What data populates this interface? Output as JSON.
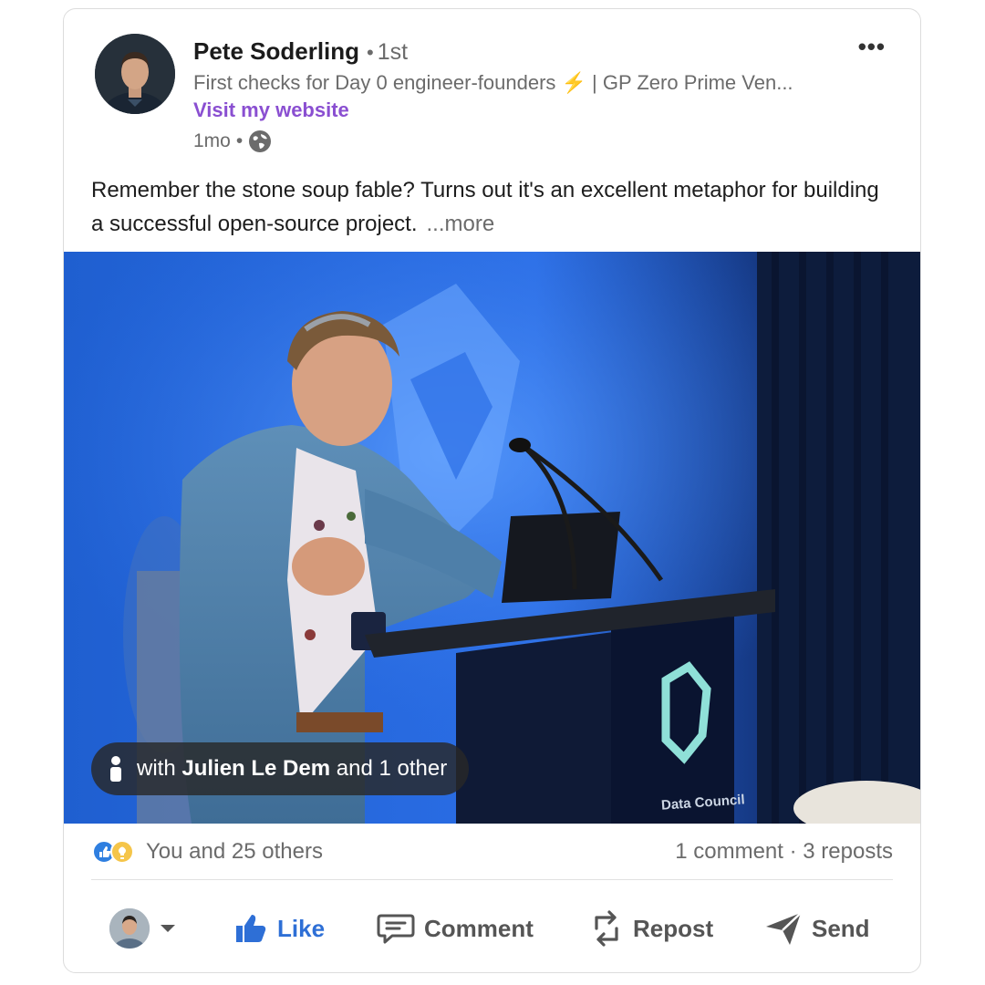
{
  "post": {
    "author": {
      "name": "Pete Soderling",
      "separator": "•",
      "degree": "1st",
      "headline_pre": "First checks for Day 0 engineer-founders ",
      "headline_bolt": "⚡",
      "headline_post": " | GP Zero Prime Ven...",
      "website_label": "Visit my website",
      "time": "1mo",
      "meta_sep": "•"
    },
    "more_menu": "•••",
    "text": "Remember the stone soup fable? Turns out it's an excellent metaphor for building a successful open-source project.",
    "see_more": "...more",
    "image": {
      "podium_label": "Data Council",
      "tag": {
        "prefix": "with",
        "name": "Julien Le Dem",
        "suffix": "and 1 other"
      }
    },
    "social": {
      "reactions_text": "You and 25 others",
      "counts_text": "1 comment · 3 reposts"
    },
    "actions": {
      "like": "Like",
      "comment": "Comment",
      "repost": "Repost",
      "send": "Send"
    }
  },
  "colors": {
    "link_purple": "#8a4fd1",
    "like_blue": "#2e6fd6",
    "muted": "#6b6b6b"
  }
}
